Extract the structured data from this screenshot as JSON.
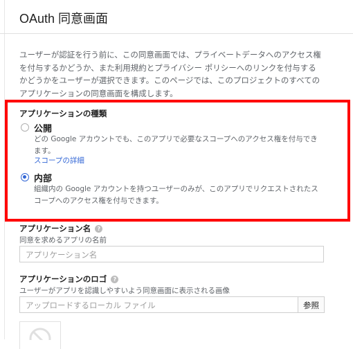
{
  "header": {
    "title": "OAuth 同意画面"
  },
  "intro": {
    "text": "ユーザーが認証を行う前に、この同意画面では、プライベートデータへのアクセス権を付与するかどうか、また利用規約とプライバシー ポリシーへのリンクを付与するかどうかをユーザーが選択できます。このページでは、このプロジェクトのすべてのアプリケーションの同意画面を構成します。"
  },
  "app_type": {
    "title": "アプリケーションの種類",
    "options": [
      {
        "label": "公開",
        "description": "どの Google アカウントでも、このアプリで必要なスコープへのアクセス権を付与できます。",
        "link": "スコープの詳細",
        "selected": false
      },
      {
        "label": "内部",
        "description": "組織内の Google アカウントを持つユーザーのみが、このアプリでリクエストされたスコープへのアクセス権を付与できます。",
        "selected": true
      }
    ]
  },
  "app_name": {
    "title": "アプリケーション名",
    "subtitle": "同意を求めるアプリの名前",
    "placeholder": "アプリケーション名",
    "help_icon": "help-icon"
  },
  "app_logo": {
    "title": "アプリケーションのロゴ",
    "subtitle": "ユーザーがアプリを認識しやすいよう同意画面に表示される画像",
    "placeholder": "アップロードするローカル ファイル",
    "browse_label": "参照",
    "help_icon": "help-icon"
  },
  "colors": {
    "accent": "#3367d6",
    "highlight": "#ff0000"
  }
}
